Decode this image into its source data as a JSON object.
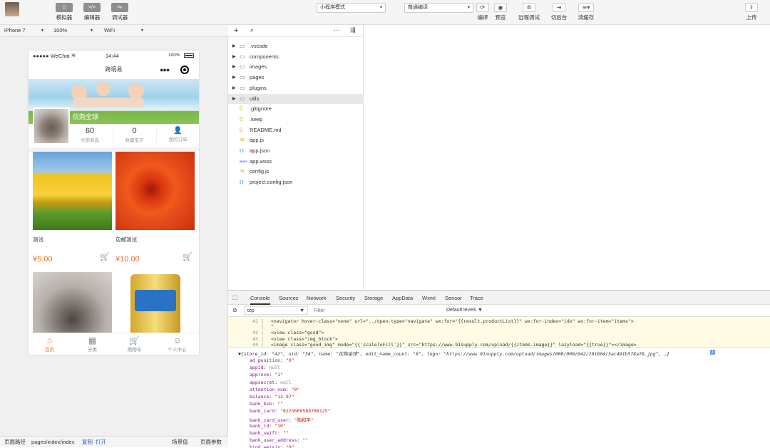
{
  "toolbar": {
    "simulator_icon": "▯",
    "simulator_label": "模拟器",
    "editor_icon": "</>",
    "editor_label": "编辑器",
    "debugger_icon": "⇆",
    "debugger_label": "调试器",
    "mode_select": "小程序模式",
    "compile_select": "普通编译",
    "compile_label": "编译",
    "preview_label": "预览",
    "remote_debug_label": "远程调试",
    "background_label": "切后台",
    "clear_cache_label": "清缓存",
    "upload_label": "上传"
  },
  "device": {
    "model": "iPhone 7",
    "zoom": "100%",
    "network": "WiFi"
  },
  "phone": {
    "carrier": "●●●●● WeChat",
    "time": "14:44",
    "battery": "100%",
    "title": "跨境易",
    "shop_name": "优购全球",
    "stats": [
      {
        "value": "60",
        "label": "全部商品"
      },
      {
        "value": "0",
        "label": "收藏宝贝"
      },
      {
        "value": "",
        "label": "我的订单"
      }
    ],
    "products": [
      {
        "name": "测试",
        "price": "¥5.00"
      },
      {
        "name": "包邮测试",
        "price": "¥10.00"
      }
    ],
    "tabs": [
      {
        "label": "首页",
        "icon": "⌂"
      },
      {
        "label": "分类",
        "icon": "▦"
      },
      {
        "label": "购物车",
        "icon": "🛒"
      },
      {
        "label": "个人中心",
        "icon": "☺"
      }
    ]
  },
  "explorer": {
    "files": [
      {
        "name": ".vscode",
        "type": "folder"
      },
      {
        "name": "components",
        "type": "folder"
      },
      {
        "name": "images",
        "type": "folder"
      },
      {
        "name": "pages",
        "type": "folder"
      },
      {
        "name": "plugins",
        "type": "folder"
      },
      {
        "name": "utils",
        "type": "folder"
      },
      {
        "name": ".gitignore",
        "type": "file"
      },
      {
        "name": ".keep",
        "type": "file"
      },
      {
        "name": "README.md",
        "type": "file"
      },
      {
        "name": "app.js",
        "type": "js"
      },
      {
        "name": "app.json",
        "type": "json"
      },
      {
        "name": "app.wxss",
        "type": "wxss"
      },
      {
        "name": "config.js",
        "type": "js"
      },
      {
        "name": "project.config.json",
        "type": "json"
      }
    ]
  },
  "devtools": {
    "tabs": [
      "Console",
      "Sources",
      "Network",
      "Security",
      "Storage",
      "AppData",
      "Wxml",
      "Sensor",
      "Trace"
    ],
    "context": "top",
    "filter_placeholder": "Filter",
    "levels": "Default levels ▼",
    "code_lines": [
      {
        "num": "41",
        "text": "<navigator hover-class=\"none\" url=\"../open-type=\"navigate\" wx:for=\"{{result.productList}}\" wx:for-index=\"idx\" wx:for-item=\"items\">"
      },
      {
        "num": "",
        "text": "^"
      },
      {
        "num": "42",
        "text": "    <view class=\"good\">"
      },
      {
        "num": "43",
        "text": "      <view class=\"img_block\">"
      },
      {
        "num": "44",
        "text": "        <image class=\"good_img\" mode=\"{{'scaleToFill'}}\" src=\"https://www.91supply.com/upload/{{items.image}}\" lazyload=\"{{true}}\"></image>"
      }
    ],
    "object_summary": "▼{store_id: \"42\", uid: \"34\", name: \"优购全球\", edit_name_count: \"8\", logo: \"https://www.91supply.com/upload/images/000/000/042/201804/5ac491b578a78.jpg\", …}",
    "props": [
      {
        "key": "ad_position",
        "val": "\"0\"",
        "t": "s"
      },
      {
        "key": "appid",
        "val": "null",
        "t": "null"
      },
      {
        "key": "approve",
        "val": "\"1\"",
        "t": "s"
      },
      {
        "key": "appsecret",
        "val": "null",
        "t": "null"
      },
      {
        "key": "attention_num",
        "val": "\"0\"",
        "t": "s"
      },
      {
        "key": "balance",
        "val": "\"13.97\"",
        "t": "s"
      },
      {
        "key": "bank_bsb",
        "val": "\"\"",
        "t": "s"
      },
      {
        "key": "bank_card",
        "val": "\"6225600588768125\"",
        "t": "s"
      },
      {
        "key": "bank_card_user",
        "val": "\"陶和平\"",
        "t": "s"
      },
      {
        "key": "bank_id",
        "val": "\"10\"",
        "t": "s"
      },
      {
        "key": "bank_swift",
        "val": "\"\"",
        "t": "s"
      },
      {
        "key": "bank_user_address",
        "val": "\"\"",
        "t": "s"
      },
      {
        "key": "bind_weixin",
        "val": "\"0\"",
        "t": "s"
      }
    ]
  },
  "statusbar": {
    "path_label": "页面路径",
    "path": "pages/index/index",
    "copy": "复制",
    "open": "打开",
    "scene": "场景值",
    "params": "页面参数"
  }
}
